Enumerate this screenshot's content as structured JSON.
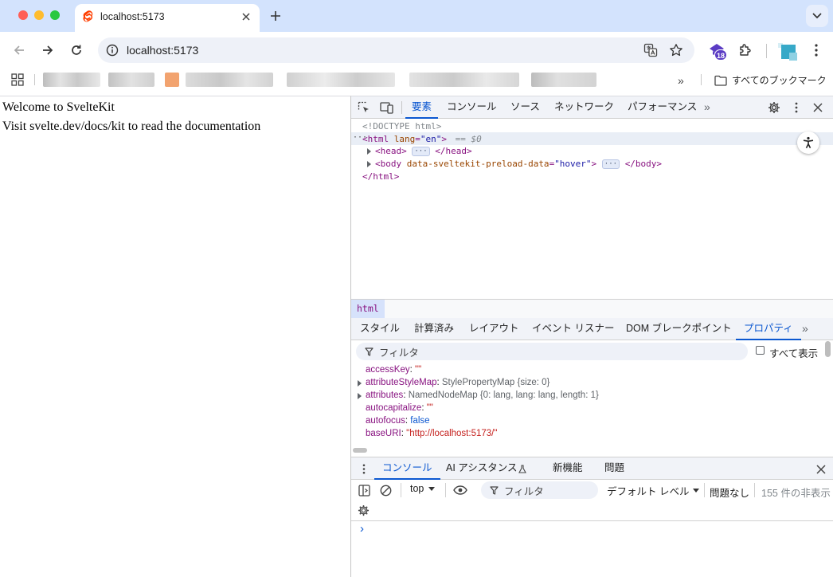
{
  "browser": {
    "tab": {
      "title": "localhost:5173",
      "favicon": "svelte-icon"
    },
    "url": "localhost:5173",
    "extension_badge": "18",
    "bookmarks_all_label": "すべてのブックマーク"
  },
  "page": {
    "heading": "Welcome to SvelteKit",
    "paragraph": "Visit svelte.dev/docs/kit to read the documentation"
  },
  "devtools": {
    "tabs": [
      "要素",
      "コンソール",
      "ソース",
      "ネットワーク",
      "パフォーマンス"
    ],
    "active_tab": "要素",
    "dom": {
      "doctype": "<!DOCTYPE html>",
      "html_open_tag": "<html",
      "html_attr_name": "lang",
      "html_attr_value": "\"en\"",
      "html_close_bracket": ">",
      "selected_marker": "== $0",
      "head_open": "<head>",
      "head_close": "</head>",
      "body_open": "<body",
      "body_attr_name": "data-sveltekit-preload-data",
      "body_attr_value": "\"hover\"",
      "body_close_bracket": ">",
      "body_close": "</body>",
      "html_close": "</html>",
      "ellipsis": "···"
    },
    "breadcrumb": "html",
    "sidebar_tabs": [
      "スタイル",
      "計算済み",
      "レイアウト",
      "イベント リスナー",
      "DOM ブレークポイント",
      "プロパティ"
    ],
    "sidebar_active": "プロパティ",
    "properties_filter_placeholder": "フィルタ",
    "show_all_label": "すべて表示",
    "properties": [
      {
        "key": "accessKey",
        "value": "\"\"",
        "kind": "string",
        "expandable": false
      },
      {
        "key": "attributeStyleMap",
        "value": "StylePropertyMap {size: 0}",
        "kind": "object",
        "expandable": true
      },
      {
        "key": "attributes",
        "value": "NamedNodeMap {0: lang, lang: lang, length: 1}",
        "kind": "object",
        "expandable": true
      },
      {
        "key": "autocapitalize",
        "value": "\"\"",
        "kind": "string",
        "expandable": false
      },
      {
        "key": "autofocus",
        "value": "false",
        "kind": "keyword",
        "expandable": false
      },
      {
        "key": "baseURI",
        "value": "\"http://localhost:5173/\"",
        "kind": "string",
        "expandable": false
      }
    ],
    "drawer_tabs": [
      "コンソール",
      "AI アシスタンス",
      "新機能",
      "問題"
    ],
    "drawer_active": "コンソール",
    "console": {
      "context": "top",
      "filter_placeholder": "フィルタ",
      "levels": "デフォルト レベル",
      "issues": "問題なし",
      "hidden": "155 件の非表示",
      "prompt": "›"
    }
  },
  "colors": {
    "tabstrip": "#d3e3fd",
    "accent": "#0b57d0",
    "tag": "#881280",
    "attr": "#994500",
    "attr_value": "#1a1aa6"
  }
}
